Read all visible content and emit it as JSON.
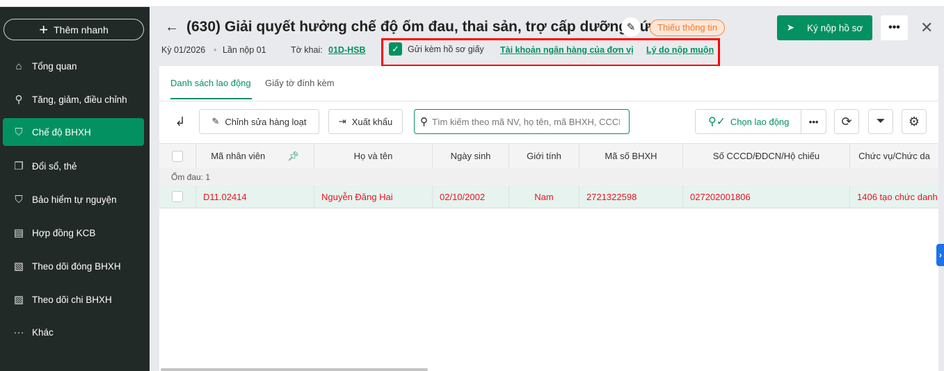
{
  "sidebar": {
    "quick_add": "Thêm nhanh",
    "items": [
      {
        "label": "Tổng quan",
        "icon": "home-icon"
      },
      {
        "label": "Tăng, giảm, điều chỉnh",
        "icon": "user-icon"
      },
      {
        "label": "Chế độ BHXH",
        "icon": "shield-icon",
        "active": true
      },
      {
        "label": "Đổi sổ, thẻ",
        "icon": "copy-icon"
      },
      {
        "label": "Bảo hiểm tự nguyện",
        "icon": "shield-icon"
      },
      {
        "label": "Hợp đồng KCB",
        "icon": "scroll-icon"
      },
      {
        "label": "Theo dõi đóng BHXH",
        "icon": "c12-document-icon"
      },
      {
        "label": "Theo dõi chi BHXH",
        "icon": "document-icon"
      },
      {
        "label": "Khác",
        "icon": "more-icon"
      }
    ]
  },
  "header": {
    "title": "(630) Giải quyết hưởng chế độ ốm đau, thai sản, trợ cấp dưỡng sứ...",
    "status_badge": "Thiếu thông tin",
    "sign_button": "Ký nộp hồ sơ",
    "period": "Kỳ 01/2026",
    "submission": "Lần nộp 01",
    "form_label": "Tờ khai:",
    "form_code": "01D-HSB",
    "paper_checkbox": "Gửi kèm hồ sơ giấy",
    "paper_checked": true,
    "bank_link": "Tài khoản ngân hàng của đơn vị",
    "late_link": "Lý do nộp muộn",
    "accent": "#049161"
  },
  "tabs": [
    {
      "label": "Danh sách lao động",
      "active": true
    },
    {
      "label": "Giấy tờ đính kèm"
    }
  ],
  "toolbar": {
    "bulk_edit": "Chỉnh sửa hàng loạt",
    "export": "Xuất khẩu",
    "search_placeholder": "Tìm kiếm theo mã NV, họ tên, mã BHXH, CCCD",
    "choose_worker": "Chọn lao động"
  },
  "table": {
    "columns": [
      "Mã nhân viên",
      "Họ và tên",
      "Ngày sinh",
      "Giới tính",
      "Mã số BHXH",
      "Số CCCD/ĐDCN/Hộ chiếu",
      "Chức vụ/Chức da"
    ],
    "group": "Ốm đau: 1",
    "rows": [
      [
        "D11.02414",
        "Nguyễn Đăng Hai",
        "02/10/2002",
        "Nam",
        "2721322598",
        "027202001806",
        "1406 tạo chức danh"
      ]
    ]
  }
}
